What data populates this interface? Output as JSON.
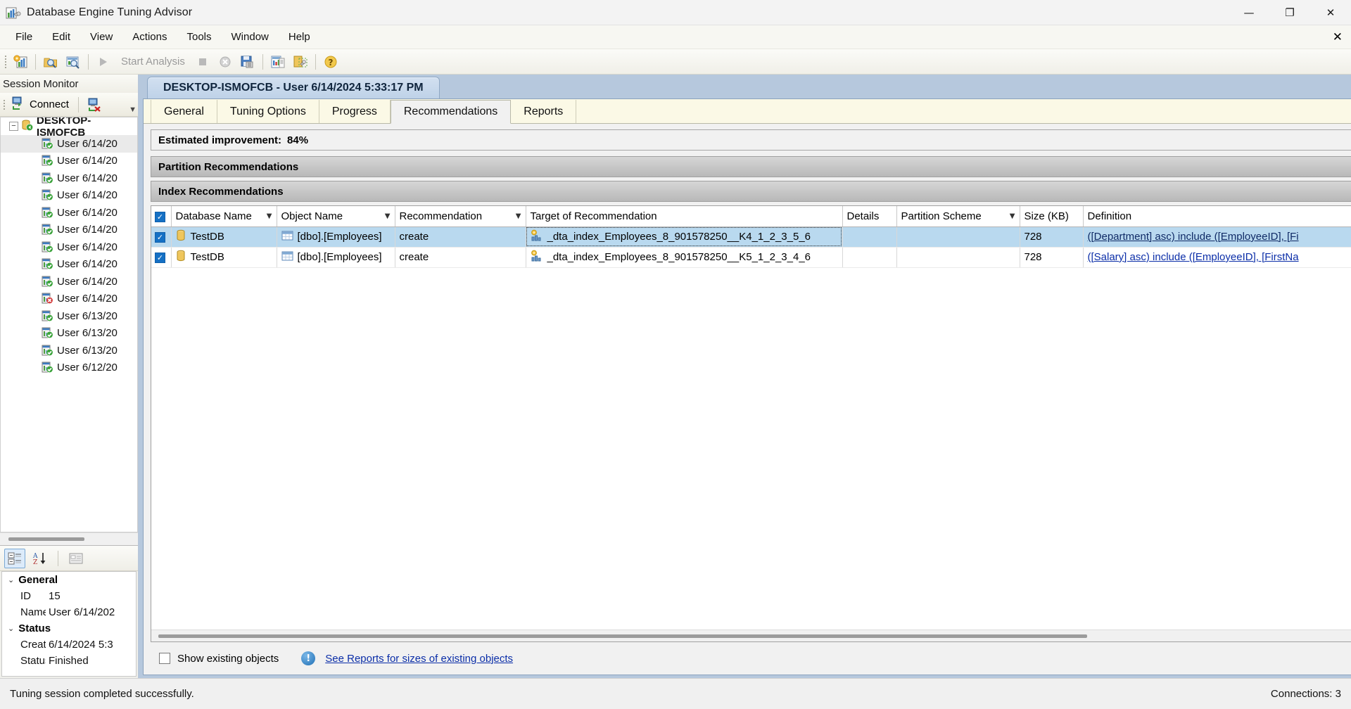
{
  "window": {
    "title": "Database Engine Tuning Advisor",
    "app_icon": "database-tuning-advisor-icon",
    "minimize": "—",
    "maximize": "❐",
    "close": "✕"
  },
  "menubar": {
    "items": [
      {
        "label": "File"
      },
      {
        "label": "Edit"
      },
      {
        "label": "View"
      },
      {
        "label": "Actions"
      },
      {
        "label": "Tools"
      },
      {
        "label": "Window"
      },
      {
        "label": "Help"
      }
    ],
    "close_document": "✕"
  },
  "toolbar": {
    "new_session_icon": "new-session-icon",
    "open_session_icon": "open-session-icon",
    "session_properties_icon": "session-properties-icon",
    "start_analysis_label": "Start Analysis",
    "stop_icon": "stop-icon",
    "stop_delete_icon": "stop-and-delete-icon",
    "save_icon": "save-session-icon",
    "reports_icon": "tuning-reports-icon",
    "tuning_log_icon": "tuning-log-icon",
    "help_icon": "help-icon"
  },
  "sidebar": {
    "title": "Session Monitor",
    "connect_label": "Connect",
    "connect_icon": "connect-server-icon",
    "disconnect_icon": "disconnect-server-icon",
    "overflow_icon": "toolbar-overflow-icon",
    "root": {
      "label": "DESKTOP-ISMOFCB",
      "icon": "server-running-icon",
      "expander": "−"
    },
    "sessions": [
      {
        "label": "User 6/14/20",
        "status": "finished",
        "icon": "session-finished-icon",
        "selected": true
      },
      {
        "label": "User 6/14/20",
        "status": "finished",
        "icon": "session-finished-icon",
        "selected": false
      },
      {
        "label": "User 6/14/20",
        "status": "finished",
        "icon": "session-finished-icon",
        "selected": false
      },
      {
        "label": "User 6/14/20",
        "status": "finished",
        "icon": "session-finished-icon",
        "selected": false
      },
      {
        "label": "User 6/14/20",
        "status": "finished",
        "icon": "session-finished-icon",
        "selected": false
      },
      {
        "label": "User 6/14/20",
        "status": "finished",
        "icon": "session-finished-icon",
        "selected": false
      },
      {
        "label": "User 6/14/20",
        "status": "finished",
        "icon": "session-finished-icon",
        "selected": false
      },
      {
        "label": "User 6/14/20",
        "status": "finished",
        "icon": "session-finished-icon",
        "selected": false
      },
      {
        "label": "User 6/14/20",
        "status": "finished",
        "icon": "session-finished-icon",
        "selected": false
      },
      {
        "label": "User 6/14/20",
        "status": "error",
        "icon": "session-error-icon",
        "selected": false
      },
      {
        "label": "User 6/13/20",
        "status": "finished",
        "icon": "session-finished-icon",
        "selected": false
      },
      {
        "label": "User 6/13/20",
        "status": "finished",
        "icon": "session-finished-icon",
        "selected": false
      },
      {
        "label": "User 6/13/20",
        "status": "finished",
        "icon": "session-finished-icon",
        "selected": false
      },
      {
        "label": "User 6/12/20",
        "status": "finished",
        "icon": "session-finished-icon",
        "selected": false
      }
    ]
  },
  "properties": {
    "toolbar": {
      "categorized_icon": "categorized-view-icon",
      "alphabetical_icon": "alphabetical-sort-icon",
      "property_pages_icon": "property-pages-icon"
    },
    "groups": [
      {
        "name": "General",
        "chevron": "⌄",
        "rows": [
          {
            "key": "ID",
            "value": "15"
          },
          {
            "key": "Name",
            "value": "User 6/14/202"
          }
        ]
      },
      {
        "name": "Status",
        "chevron": "⌄",
        "rows": [
          {
            "key": "Creatic",
            "value": "6/14/2024 5:3"
          },
          {
            "key": "Status",
            "value": "Finished"
          }
        ]
      }
    ]
  },
  "document": {
    "tab_title": "DESKTOP-ISMOFCB - User 6/14/2024 5:33:17 PM",
    "tabs": [
      {
        "label": "General",
        "active": false
      },
      {
        "label": "Tuning Options",
        "active": false
      },
      {
        "label": "Progress",
        "active": false
      },
      {
        "label": "Recommendations",
        "active": true
      },
      {
        "label": "Reports",
        "active": false
      }
    ]
  },
  "recommendations": {
    "estimated_improvement_label": "Estimated improvement:",
    "estimated_improvement_value": "84%",
    "partition_section": {
      "title": "Partition Recommendations",
      "expand_icon": "double-chevron-down-icon"
    },
    "index_section": {
      "title": "Index Recommendations",
      "expand_icon": "double-chevron-down-icon"
    },
    "columns": [
      {
        "label": "",
        "filter": false,
        "key": "check"
      },
      {
        "label": "Database Name",
        "filter": true,
        "key": "database_name"
      },
      {
        "label": "Object Name",
        "filter": true,
        "key": "object_name"
      },
      {
        "label": "Recommendation",
        "filter": true,
        "key": "recommendation"
      },
      {
        "label": "Target of Recommendation",
        "filter": false,
        "key": "target"
      },
      {
        "label": "Details",
        "filter": false,
        "key": "details"
      },
      {
        "label": "Partition Scheme",
        "filter": true,
        "key": "partition_scheme"
      },
      {
        "label": "Size (KB)",
        "filter": false,
        "key": "size_kb"
      },
      {
        "label": "Definition",
        "filter": false,
        "key": "definition"
      }
    ],
    "rows": [
      {
        "checked": true,
        "database_name": "TestDB",
        "object_name": "[dbo].[Employees]",
        "recommendation": "create",
        "target": "_dta_index_Employees_8_901578250__K4_1_2_3_5_6",
        "details": "",
        "partition_scheme": "",
        "size_kb": "728",
        "definition": "([Department] asc) include ([EmployeeID], [Fi",
        "selected": true
      },
      {
        "checked": true,
        "database_name": "TestDB",
        "object_name": "[dbo].[Employees]",
        "recommendation": "create",
        "target": "_dta_index_Employees_8_901578250__K5_1_2_3_4_6",
        "details": "",
        "partition_scheme": "",
        "size_kb": "728",
        "definition": "([Salary] asc) include ([EmployeeID], [FirstNa",
        "selected": false
      }
    ],
    "show_existing_objects_label": "Show existing objects",
    "show_existing_objects_checked": false,
    "info_icon": "info-icon",
    "reports_link": "See Reports for sizes of existing objects"
  },
  "statusbar": {
    "message": "Tuning session completed successfully.",
    "connections": "Connections: 3"
  }
}
